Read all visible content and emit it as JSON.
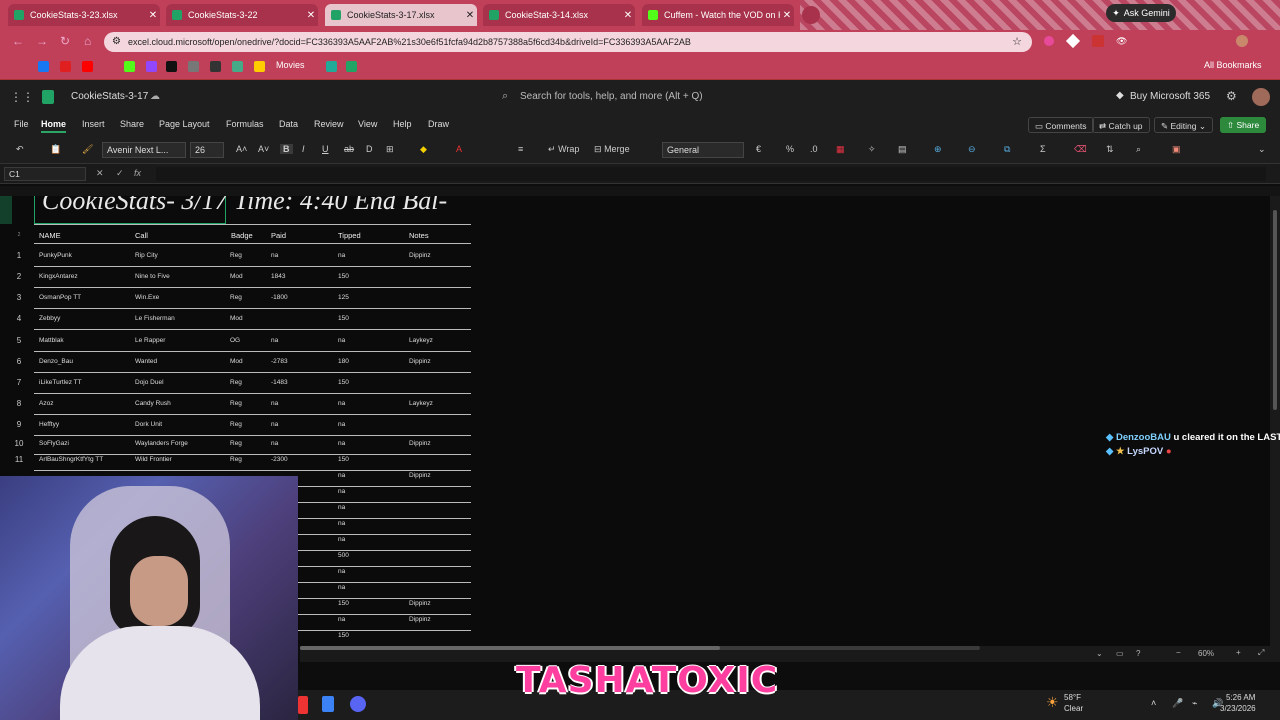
{
  "browser": {
    "tabs": [
      {
        "label": "CookieStats-3-23.xlsx",
        "icon": "excel-icon"
      },
      {
        "label": "CookieStats-3-22",
        "icon": "excel-icon"
      },
      {
        "label": "CookieStats-3-17.xlsx",
        "icon": "excel-icon",
        "active": true
      },
      {
        "label": "CookieStat-3-14.xlsx",
        "icon": "excel-icon"
      },
      {
        "label": "Cuffem - Watch the VOD on Ki",
        "icon": "kick-icon"
      }
    ],
    "gemini_label": "Ask Gemini",
    "url": "excel.cloud.microsoft/open/onedrive/?docid=FC336393A5AAF2AB%21s30e6f51fcfa94d2b8757388a5f6cd34b&driveId=FC336393A5AAF2AB",
    "bookmarks_movies": "Movies",
    "all_bookmarks": "All Bookmarks"
  },
  "excel": {
    "file_name": "CookieStats-3-17",
    "search_placeholder": "Search for tools, help, and more (Alt + Q)",
    "buy_label": "Buy Microsoft 365",
    "menu": [
      "File",
      "Home",
      "Insert",
      "Share",
      "Page Layout",
      "Formulas",
      "Data",
      "Review",
      "View",
      "Help",
      "Draw"
    ],
    "comments_label": "Comments",
    "catchup_label": "Catch up",
    "editing_label": "Editing",
    "share_label": "Share",
    "font_name": "Avenir Next L...",
    "font_size": "26",
    "wrap_label": "Wrap",
    "merge_label": "Merge",
    "number_format": "General",
    "name_box": "C1",
    "fx_label": "fx",
    "sheet_title": "CookieStats- 3/17  Time: 4:40 End Bal-",
    "columns": [
      "NAME",
      "Call",
      "Badge",
      "Paid",
      "Tipped",
      "Notes"
    ],
    "rows": [
      {
        "num": "1",
        "name": "PunkyPunk",
        "call": "Rip City",
        "badge": "Reg",
        "paid": "na",
        "tipped": "na",
        "notes": "Dippinz"
      },
      {
        "num": "2",
        "name": "KingxAntarez",
        "call": "Nine to Five",
        "badge": "Mod",
        "paid": "1843",
        "tipped": "150",
        "notes": ""
      },
      {
        "num": "3",
        "name": "OsmanPop TT",
        "call": "Win.Exe",
        "badge": "Reg",
        "paid": "-1800",
        "tipped": "125",
        "notes": ""
      },
      {
        "num": "4",
        "name": "Zebbyy",
        "call": "Le Fisherman",
        "badge": "Mod",
        "paid": "",
        "tipped": "150",
        "notes": ""
      },
      {
        "num": "5",
        "name": "Mattblak",
        "call": "Le Rapper",
        "badge": "OG",
        "paid": "na",
        "tipped": "na",
        "notes": "Laykeyz"
      },
      {
        "num": "6",
        "name": "Denzo_Bau",
        "call": "Wanted",
        "badge": "Mod",
        "paid": "-2783",
        "tipped": "180",
        "notes": "Dippinz"
      },
      {
        "num": "7",
        "name": "iLikeTurtlez TT",
        "call": "Dojo Duel",
        "badge": "Reg",
        "paid": "-1483",
        "tipped": "150",
        "notes": ""
      },
      {
        "num": "8",
        "name": "Azoz",
        "call": "Candy Rush",
        "badge": "Reg",
        "paid": "na",
        "tipped": "na",
        "notes": "Laykeyz"
      },
      {
        "num": "9",
        "name": "Hefftyy",
        "call": "Dork Unit",
        "badge": "Reg",
        "paid": "na",
        "tipped": "na",
        "notes": ""
      },
      {
        "num": "10",
        "name": "SoFlyGazi",
        "call": "Waylanders Forge",
        "badge": "Reg",
        "paid": "na",
        "tipped": "na",
        "notes": "Dippinz"
      },
      {
        "num": "11",
        "name": "ArlBauShngrKtfYtg TT",
        "call": "Wild Frontier",
        "badge": "Reg",
        "paid": "-2300",
        "tipped": "150",
        "notes": ""
      }
    ],
    "partial_tipped": [
      "na",
      "na",
      "na",
      "na",
      "na",
      "500",
      "na",
      "na",
      "150",
      "na",
      "150"
    ],
    "partial_notes": [
      "Dippinz",
      "",
      "",
      "",
      "",
      "",
      "",
      "",
      "Dippinz",
      "Dippinz",
      ""
    ],
    "zoom": "60%"
  },
  "chat": [
    {
      "user": "DenzooBAU",
      "message": "u cleared it on the LAST"
    },
    {
      "user": "LysPOV",
      "message": ""
    }
  ],
  "stream": {
    "brand": "TASHATOXIC"
  },
  "taskbar": {
    "temp": "58°F",
    "weather": "Clear",
    "time": "5:26 AM",
    "date": "3/23/2026"
  },
  "colors": {
    "browser_frame": "#c0405a",
    "excel_green": "#21a366",
    "brand_pink": "#ff3fa0",
    "chat_user": "#7fd0ff"
  }
}
